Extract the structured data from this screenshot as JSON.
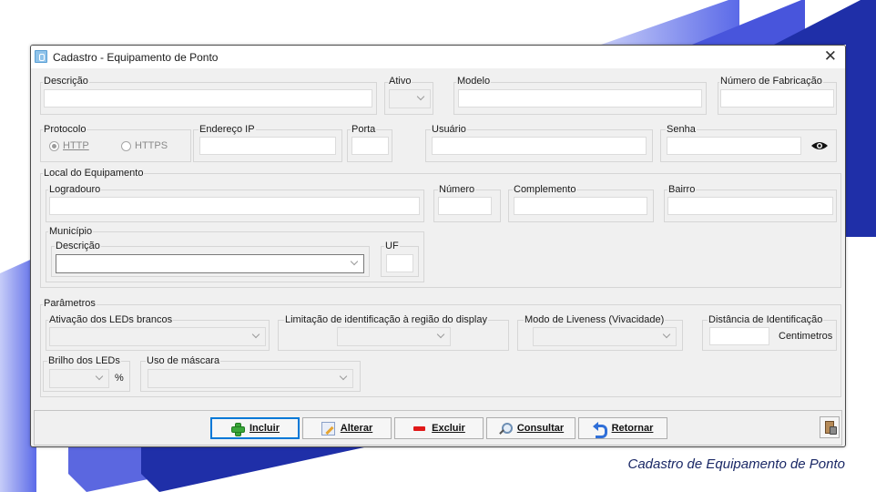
{
  "window": {
    "title": "Cadastro - Equipamento de Ponto",
    "close_glyph": "✕"
  },
  "fields": {
    "descricao": {
      "label": "Descrição",
      "value": ""
    },
    "ativo": {
      "label": "Ativo",
      "value": ""
    },
    "modelo": {
      "label": "Modelo",
      "value": ""
    },
    "numero_fabricacao": {
      "label": "Número de Fabricação",
      "value": ""
    }
  },
  "protocolo": {
    "label": "Protocolo",
    "http": "HTTP",
    "https": "HTTPS",
    "selected": "HTTP"
  },
  "conexao": {
    "endereco_ip": {
      "label": "Endereço IP",
      "value": ""
    },
    "porta": {
      "label": "Porta",
      "value": ""
    },
    "usuario": {
      "label": "Usuário",
      "value": ""
    },
    "senha": {
      "label": "Senha",
      "value": "",
      "toggle_icon": "eye-icon"
    }
  },
  "local": {
    "label": "Local do Equipamento",
    "logradouro": "Logradouro",
    "numero": "Número",
    "complemento": "Complemento",
    "bairro": "Bairro",
    "municipio": {
      "label": "Município",
      "descricao": "Descrição",
      "uf": "UF"
    }
  },
  "parametros": {
    "label": "Parâmetros",
    "ativacao_leds": "Ativação dos LEDs brancos",
    "limitacao": "Limitação de identificação à região do display",
    "modo_liveness": "Modo de Liveness (Vivacidade)",
    "distancia": {
      "label": "Distância de Identificação",
      "unit": "Centimetros"
    },
    "brilho": {
      "label": "Brilho dos LEDs",
      "unit": "%"
    },
    "uso_mascara": "Uso de máscara"
  },
  "buttons": {
    "incluir": "Incluir",
    "alterar": "Alterar",
    "excluir": "Excluir",
    "consultar": "Consultar",
    "retornar": "Retornar"
  },
  "caption": "Cadastro de Equipamento de Ponto",
  "colors": {
    "accent": "#2d3fd0",
    "accent_dark": "#1a2a9a",
    "caption": "#1a2866",
    "focus": "#0078d7"
  }
}
